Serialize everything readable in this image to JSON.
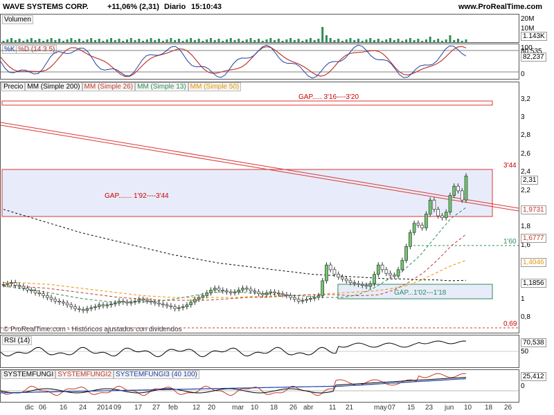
{
  "header": {
    "symbol": "WAVE SYSTEMS CORP.",
    "change": "+11,06% (2,31)",
    "period": "Diario",
    "time": "15:10:43",
    "brand": "www.ProRealTime.com"
  },
  "volume_panel": {
    "label": "Volumen",
    "axis": [
      "20M",
      "10M"
    ],
    "last": "1.143K"
  },
  "stoch_panel": {
    "label_k": "%K",
    "label_d": "%D (14 3 5)",
    "axis": [
      "100",
      "80,535",
      "0"
    ],
    "last": "82,237"
  },
  "price_panel": {
    "legend": [
      "Precio",
      "MM (Simple 200)",
      "MM (Simple 26)",
      "MM (Simple 13)",
      "MM (Simple 50)"
    ],
    "legend_colors": [
      "#000000",
      "#000000",
      "#c0392b",
      "#2e8b57",
      "#e69500"
    ],
    "gap_top": "GAP..... 3'16----3'20",
    "gap_mid": "GAP....... 1'92----3'44",
    "gap_mid_label": "3'44",
    "gap_low": "GAP...1'02---1'18",
    "level_160": "1'60",
    "level_069": "0,69",
    "footer": "© ProRealTime.com - Históricos ajustados con dividendos",
    "axis": [
      "3,2",
      "3",
      "2,8",
      "2,6",
      "2,4",
      "2,2",
      "1,8",
      "1,6",
      "1",
      "0,8"
    ],
    "tags": [
      {
        "text": "2,31",
        "color": "#000000"
      },
      {
        "text": "1,9731",
        "color": "#c0392b"
      },
      {
        "text": "1,6777",
        "color": "#c0392b"
      },
      {
        "text": "1,4046",
        "color": "#e69500"
      },
      {
        "text": "1,1856",
        "color": "#000000"
      }
    ]
  },
  "rsi_panel": {
    "label": "RSI (14)",
    "axis": [
      "50"
    ],
    "last": "70,538"
  },
  "sf_panel": {
    "label1": "SYSTEMFUNGI",
    "label2": "SYSTEMFUNGI2",
    "label3": "SYSTEMFUNGI3 (40 100)",
    "axis": [
      "0"
    ],
    "last": "25,412"
  },
  "xaxis": {
    "labels": [
      "dic",
      "06",
      "16",
      "24",
      "2014",
      "09",
      "17",
      "27",
      "feb",
      "12",
      "20",
      "mar",
      "10",
      "18",
      "26",
      "abr",
      "11",
      "21",
      "may",
      "07",
      "15",
      "23",
      "jun",
      "10",
      "18",
      "26"
    ]
  },
  "chart_data": {
    "type": "candlestick",
    "title": "WAVE SYSTEMS CORP.",
    "ylim": [
      0.62,
      3.32
    ],
    "gaps": [
      {
        "label": "GAP..... 3'16----3'20",
        "low": 3.16,
        "high": 3.2
      },
      {
        "label": "GAP....... 1'92----3'44",
        "low": 1.92,
        "high": 3.44
      },
      {
        "label": "GAP...1'02---1'18",
        "low": 1.02,
        "high": 1.18
      }
    ],
    "close": [
      1.14,
      1.15,
      1.16,
      1.13,
      1.12,
      1.1,
      1.08,
      1.07,
      1.05,
      1.04,
      1.02,
      1.0,
      0.98,
      0.96,
      0.95,
      0.94,
      0.92,
      0.9,
      0.88,
      0.87,
      0.86,
      0.88,
      0.89,
      0.9,
      0.92,
      0.91,
      0.92,
      0.93,
      0.94,
      0.96,
      0.95,
      0.94,
      0.95,
      0.96,
      0.98,
      0.97,
      0.96,
      0.95,
      0.94,
      0.93,
      0.92,
      0.91,
      0.9,
      0.88,
      0.89,
      0.9,
      0.92,
      0.95,
      0.98,
      1.0,
      1.02,
      1.05,
      1.08,
      1.1,
      1.08,
      1.07,
      1.06,
      1.05,
      1.06,
      1.08,
      1.1,
      1.09,
      1.07,
      1.06,
      1.04,
      1.03,
      1.05,
      1.06,
      1.05,
      1.04,
      1.03,
      1.02,
      1.0,
      0.98,
      0.96,
      0.97,
      0.98,
      0.99,
      1.0,
      1.02,
      1.18,
      1.35,
      1.3,
      1.25,
      1.22,
      1.2,
      1.18,
      1.16,
      1.15,
      1.14,
      1.13,
      1.12,
      1.15,
      1.25,
      1.35,
      1.3,
      1.26,
      1.24,
      1.23,
      1.3,
      1.4,
      1.55,
      1.7,
      1.8,
      1.78,
      1.75,
      1.9,
      2.05,
      1.95,
      1.88,
      1.86,
      1.92,
      2.1,
      2.2,
      2.15,
      2.05,
      2.31
    ],
    "sma200": [
      1.95,
      1.9,
      1.85,
      1.8,
      1.75,
      1.7,
      1.66,
      1.62,
      1.58,
      1.54,
      1.5,
      1.46,
      1.43,
      1.4,
      1.37,
      1.35,
      1.33,
      1.31,
      1.29,
      1.27,
      1.25,
      1.24,
      1.23,
      1.22,
      1.21,
      1.2,
      1.2,
      1.19,
      1.19,
      1.18,
      1.185
    ],
    "sma26": [
      1.13,
      1.12,
      1.11,
      1.1,
      1.08,
      1.06,
      1.04,
      1.02,
      1.0,
      0.99,
      0.98,
      0.97,
      0.97,
      0.97,
      0.97,
      0.98,
      0.99,
      1.0,
      1.0,
      1.01,
      1.02,
      1.03,
      1.03,
      1.03,
      1.02,
      1.02,
      1.03,
      1.08,
      1.16,
      1.26,
      1.4,
      1.56,
      1.68
    ],
    "sma13": [
      1.12,
      1.1,
      1.08,
      1.05,
      1.02,
      0.99,
      0.97,
      0.95,
      0.95,
      0.95,
      0.96,
      0.98,
      1.01,
      1.04,
      1.06,
      1.06,
      1.05,
      1.04,
      1.03,
      1.02,
      1.01,
      1.0,
      1.0,
      1.03,
      1.1,
      1.2,
      1.3,
      1.45,
      1.65,
      1.85,
      1.97
    ],
    "sma50": [
      1.16,
      1.16,
      1.15,
      1.14,
      1.12,
      1.1,
      1.08,
      1.06,
      1.04,
      1.02,
      1.01,
      1.0,
      1.0,
      1.0,
      1.0,
      1.0,
      1.01,
      1.01,
      1.02,
      1.02,
      1.03,
      1.04,
      1.05,
      1.06,
      1.07,
      1.09,
      1.12,
      1.18,
      1.26,
      1.34,
      1.4
    ]
  }
}
